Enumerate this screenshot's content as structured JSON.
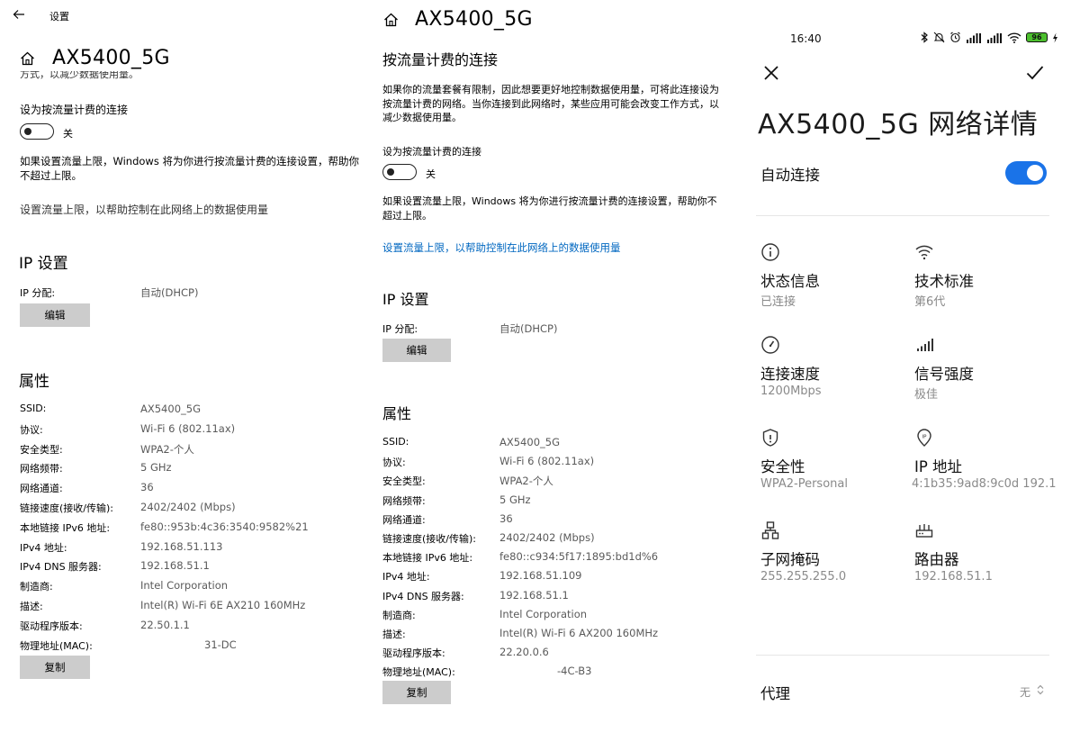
{
  "win1": {
    "back_title": "设置",
    "title": "AX5400_5G",
    "cut_text": "方式，以减少数据使用量。",
    "metered_label": "设为按流量计费的连接",
    "toggle_state": "关",
    "limit_desc": "如果设置流量上限，Windows 将为你进行按流量计费的连接设置，帮助你不超过上限。",
    "limit_link": "设置流量上限，以帮助控制在此网络上的数据使用量",
    "ip_heading": "IP 设置",
    "ip_assign_label": "IP 分配:",
    "ip_assign_value": "自动(DHCP)",
    "edit_button": "编辑",
    "props_heading": "属性",
    "props": [
      {
        "k": "SSID:",
        "v": "AX5400_5G"
      },
      {
        "k": "协议:",
        "v": "Wi-Fi 6 (802.11ax)"
      },
      {
        "k": "安全类型:",
        "v": "WPA2-个人"
      },
      {
        "k": "网络频带:",
        "v": "5 GHz"
      },
      {
        "k": "网络通道:",
        "v": "36"
      },
      {
        "k": "链接速度(接收/传输):",
        "v": "2402/2402 (Mbps)"
      },
      {
        "k": "本地链接 IPv6 地址:",
        "v": "fe80::953b:4c36:3540:9582%21"
      },
      {
        "k": "IPv4 地址:",
        "v": "192.168.51.113"
      },
      {
        "k": "IPv4 DNS 服务器:",
        "v": "192.168.51.1"
      },
      {
        "k": "制造商:",
        "v": "Intel Corporation"
      },
      {
        "k": "描述:",
        "v": "Intel(R) Wi-Fi 6E AX210 160MHz"
      },
      {
        "k": "驱动程序版本:",
        "v": "22.50.1.1"
      },
      {
        "k": "物理地址(MAC):",
        "v": "31-DC"
      }
    ],
    "copy_button": "复制"
  },
  "win2": {
    "title": "AX5400_5G",
    "metered_heading": "按流量计费的连接",
    "metered_desc": "如果你的流量套餐有限制，因此想要更好地控制数据使用量，可将此连接设为按流量计费的网络。当你连接到此网络时，某些应用可能会改变工作方式，以减少数据使用量。",
    "metered_label": "设为按流量计费的连接",
    "toggle_state": "关",
    "limit_desc": "如果设置流量上限，Windows 将为你进行按流量计费的连接设置，帮助你不超过上限。",
    "limit_link": "设置流量上限，以帮助控制在此网络上的数据使用量",
    "ip_heading": "IP 设置",
    "ip_assign_label": "IP 分配:",
    "ip_assign_value": "自动(DHCP)",
    "edit_button": "编辑",
    "props_heading": "属性",
    "props": [
      {
        "k": "SSID:",
        "v": "AX5400_5G"
      },
      {
        "k": "协议:",
        "v": "Wi-Fi 6 (802.11ax)"
      },
      {
        "k": "安全类型:",
        "v": "WPA2-个人"
      },
      {
        "k": "网络频带:",
        "v": "5 GHz"
      },
      {
        "k": "网络通道:",
        "v": "36"
      },
      {
        "k": "链接速度(接收/传输):",
        "v": "2402/2402 (Mbps)"
      },
      {
        "k": "本地链接 IPv6 地址:",
        "v": "fe80::c934:5f17:1895:bd1d%6"
      },
      {
        "k": "IPv4 地址:",
        "v": "192.168.51.109"
      },
      {
        "k": "IPv4 DNS 服务器:",
        "v": "192.168.51.1"
      },
      {
        "k": "制造商:",
        "v": "Intel Corporation"
      },
      {
        "k": "描述:",
        "v": "Intel(R) Wi-Fi 6 AX200 160MHz"
      },
      {
        "k": "驱动程序版本:",
        "v": "22.20.0.6"
      },
      {
        "k": "物理地址(MAC):",
        "v": "-4C-B3"
      }
    ],
    "copy_button": "复制"
  },
  "phone": {
    "time": "16:40",
    "battery": "96",
    "title": "AX5400_5G 网络详情",
    "auto_connect_label": "自动连接",
    "accent_color": "#1a73e8",
    "details": [
      {
        "icon": "info-icon",
        "label": "状态信息",
        "value": "已连接"
      },
      {
        "icon": "wifi-icon",
        "label": "技术标准",
        "value": "第6代"
      },
      {
        "icon": "speed-gauge-icon",
        "label": "连接速度",
        "value": "1200Mbps"
      },
      {
        "icon": "signal-bars-icon",
        "label": "信号强度",
        "value": "极佳"
      },
      {
        "icon": "shield-icon",
        "label": "安全性",
        "value": "WPA2-Personal"
      },
      {
        "icon": "ip-pin-icon",
        "label": "IP 地址",
        "value": "4:1b35:9ad8:9c0d 192.1"
      },
      {
        "icon": "subnet-icon",
        "label": "子网掩码",
        "value": "255.255.255.0"
      },
      {
        "icon": "router-icon",
        "label": "路由器",
        "value": "192.168.51.1"
      }
    ],
    "proxy_label": "代理",
    "proxy_value": "无"
  }
}
